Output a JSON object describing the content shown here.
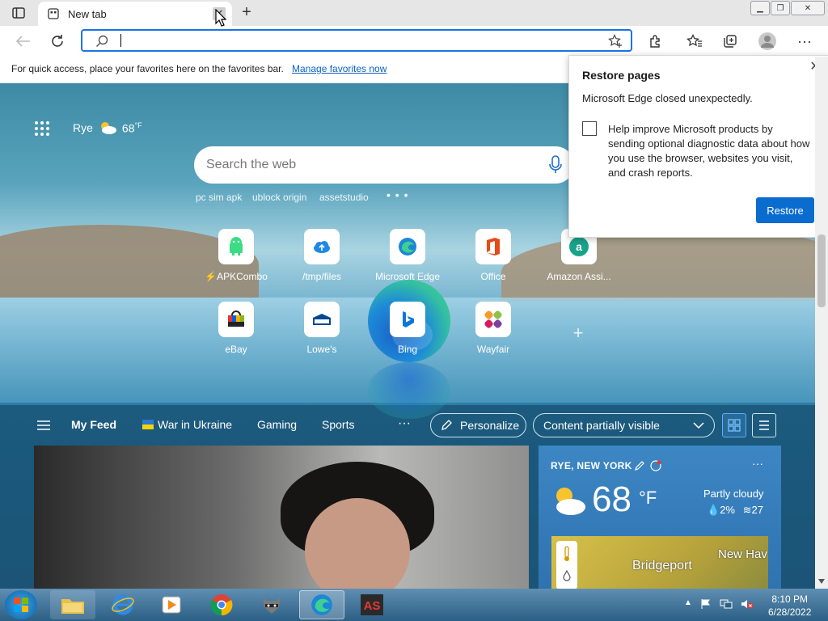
{
  "browser": {
    "tab_title": "New tab",
    "tab_close": "✕",
    "new_tab": "+",
    "address_value": "",
    "favbar_text": "For quick access, place your favorites here on the favorites bar.",
    "favbar_link": "Manage favorites now"
  },
  "newtab": {
    "location": "Rye",
    "temp": "68",
    "temp_unit": "°F",
    "search_placeholder": "Search the web",
    "suggestions": [
      "pc sim apk",
      "ublock origin",
      "assetstudio"
    ],
    "more": "• • •",
    "tiles": [
      {
        "label": "⚡APKCombo",
        "icon": "apkcombo-icon"
      },
      {
        "label": "/tmp/files",
        "icon": "cloud-upload-icon"
      },
      {
        "label": "Microsoft Edge",
        "icon": "edge-icon"
      },
      {
        "label": "Office",
        "icon": "office-icon"
      },
      {
        "label": "Amazon Assi...",
        "icon": "amazon-icon"
      },
      {
        "label": "eBay",
        "icon": "ebay-icon"
      },
      {
        "label": "Lowe's",
        "icon": "lowes-icon"
      },
      {
        "label": "Bing",
        "icon": "bing-icon"
      },
      {
        "label": "Wayfair",
        "icon": "wayfair-icon"
      }
    ]
  },
  "feed": {
    "my_feed": "My Feed",
    "tabs": [
      "War in Ukraine",
      "Gaming",
      "Sports"
    ],
    "more": "···",
    "personalize": "Personalize",
    "content_visibility": "Content partially visible"
  },
  "weather_card": {
    "location": "RYE, NEW YORK",
    "temp": "68",
    "unit": "°F",
    "condition": "Partly cloudy",
    "precip": "2%",
    "wind": "27",
    "map_city1": "Bridgeport",
    "map_city2": "New Hav"
  },
  "popup": {
    "title": "Restore pages",
    "message": "Microsoft Edge closed unexpectedly.",
    "checkbox_text": "Help improve Microsoft products by sending optional diagnostic data about how you use the browser, websites you visit, and crash reports.",
    "restore_label": "Restore"
  },
  "taskbar": {
    "time": "8:10 PM",
    "date": "6/28/2022"
  },
  "colors": {
    "accent": "#0a6ccf",
    "address_focus": "#1a73e8"
  }
}
